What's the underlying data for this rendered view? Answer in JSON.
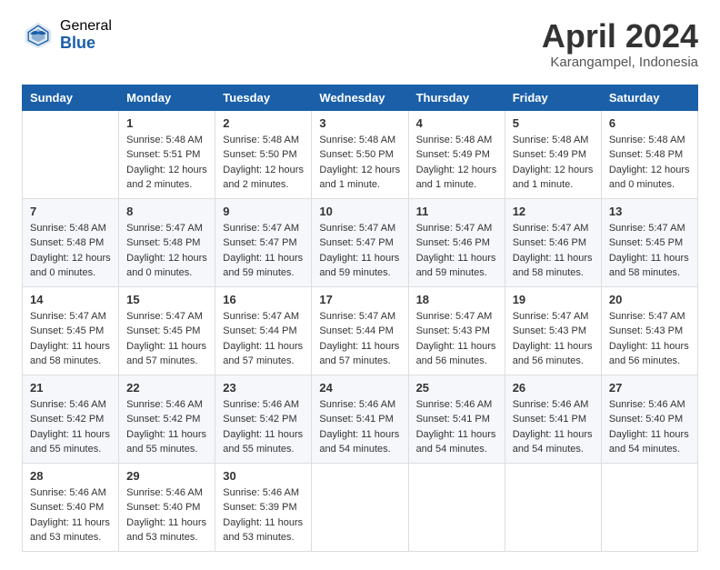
{
  "header": {
    "logo_general": "General",
    "logo_blue": "Blue",
    "month_title": "April 2024",
    "location": "Karangampel, Indonesia"
  },
  "calendar": {
    "days_of_week": [
      "Sunday",
      "Monday",
      "Tuesday",
      "Wednesday",
      "Thursday",
      "Friday",
      "Saturday"
    ],
    "weeks": [
      [
        {
          "day": "",
          "info": ""
        },
        {
          "day": "1",
          "info": "Sunrise: 5:48 AM\nSunset: 5:51 PM\nDaylight: 12 hours\nand 2 minutes."
        },
        {
          "day": "2",
          "info": "Sunrise: 5:48 AM\nSunset: 5:50 PM\nDaylight: 12 hours\nand 2 minutes."
        },
        {
          "day": "3",
          "info": "Sunrise: 5:48 AM\nSunset: 5:50 PM\nDaylight: 12 hours\nand 1 minute."
        },
        {
          "day": "4",
          "info": "Sunrise: 5:48 AM\nSunset: 5:49 PM\nDaylight: 12 hours\nand 1 minute."
        },
        {
          "day": "5",
          "info": "Sunrise: 5:48 AM\nSunset: 5:49 PM\nDaylight: 12 hours\nand 1 minute."
        },
        {
          "day": "6",
          "info": "Sunrise: 5:48 AM\nSunset: 5:48 PM\nDaylight: 12 hours\nand 0 minutes."
        }
      ],
      [
        {
          "day": "7",
          "info": "Sunrise: 5:48 AM\nSunset: 5:48 PM\nDaylight: 12 hours\nand 0 minutes."
        },
        {
          "day": "8",
          "info": "Sunrise: 5:47 AM\nSunset: 5:48 PM\nDaylight: 12 hours\nand 0 minutes."
        },
        {
          "day": "9",
          "info": "Sunrise: 5:47 AM\nSunset: 5:47 PM\nDaylight: 11 hours\nand 59 minutes."
        },
        {
          "day": "10",
          "info": "Sunrise: 5:47 AM\nSunset: 5:47 PM\nDaylight: 11 hours\nand 59 minutes."
        },
        {
          "day": "11",
          "info": "Sunrise: 5:47 AM\nSunset: 5:46 PM\nDaylight: 11 hours\nand 59 minutes."
        },
        {
          "day": "12",
          "info": "Sunrise: 5:47 AM\nSunset: 5:46 PM\nDaylight: 11 hours\nand 58 minutes."
        },
        {
          "day": "13",
          "info": "Sunrise: 5:47 AM\nSunset: 5:45 PM\nDaylight: 11 hours\nand 58 minutes."
        }
      ],
      [
        {
          "day": "14",
          "info": "Sunrise: 5:47 AM\nSunset: 5:45 PM\nDaylight: 11 hours\nand 58 minutes."
        },
        {
          "day": "15",
          "info": "Sunrise: 5:47 AM\nSunset: 5:45 PM\nDaylight: 11 hours\nand 57 minutes."
        },
        {
          "day": "16",
          "info": "Sunrise: 5:47 AM\nSunset: 5:44 PM\nDaylight: 11 hours\nand 57 minutes."
        },
        {
          "day": "17",
          "info": "Sunrise: 5:47 AM\nSunset: 5:44 PM\nDaylight: 11 hours\nand 57 minutes."
        },
        {
          "day": "18",
          "info": "Sunrise: 5:47 AM\nSunset: 5:43 PM\nDaylight: 11 hours\nand 56 minutes."
        },
        {
          "day": "19",
          "info": "Sunrise: 5:47 AM\nSunset: 5:43 PM\nDaylight: 11 hours\nand 56 minutes."
        },
        {
          "day": "20",
          "info": "Sunrise: 5:47 AM\nSunset: 5:43 PM\nDaylight: 11 hours\nand 56 minutes."
        }
      ],
      [
        {
          "day": "21",
          "info": "Sunrise: 5:46 AM\nSunset: 5:42 PM\nDaylight: 11 hours\nand 55 minutes."
        },
        {
          "day": "22",
          "info": "Sunrise: 5:46 AM\nSunset: 5:42 PM\nDaylight: 11 hours\nand 55 minutes."
        },
        {
          "day": "23",
          "info": "Sunrise: 5:46 AM\nSunset: 5:42 PM\nDaylight: 11 hours\nand 55 minutes."
        },
        {
          "day": "24",
          "info": "Sunrise: 5:46 AM\nSunset: 5:41 PM\nDaylight: 11 hours\nand 54 minutes."
        },
        {
          "day": "25",
          "info": "Sunrise: 5:46 AM\nSunset: 5:41 PM\nDaylight: 11 hours\nand 54 minutes."
        },
        {
          "day": "26",
          "info": "Sunrise: 5:46 AM\nSunset: 5:41 PM\nDaylight: 11 hours\nand 54 minutes."
        },
        {
          "day": "27",
          "info": "Sunrise: 5:46 AM\nSunset: 5:40 PM\nDaylight: 11 hours\nand 54 minutes."
        }
      ],
      [
        {
          "day": "28",
          "info": "Sunrise: 5:46 AM\nSunset: 5:40 PM\nDaylight: 11 hours\nand 53 minutes."
        },
        {
          "day": "29",
          "info": "Sunrise: 5:46 AM\nSunset: 5:40 PM\nDaylight: 11 hours\nand 53 minutes."
        },
        {
          "day": "30",
          "info": "Sunrise: 5:46 AM\nSunset: 5:39 PM\nDaylight: 11 hours\nand 53 minutes."
        },
        {
          "day": "",
          "info": ""
        },
        {
          "day": "",
          "info": ""
        },
        {
          "day": "",
          "info": ""
        },
        {
          "day": "",
          "info": ""
        }
      ]
    ]
  }
}
